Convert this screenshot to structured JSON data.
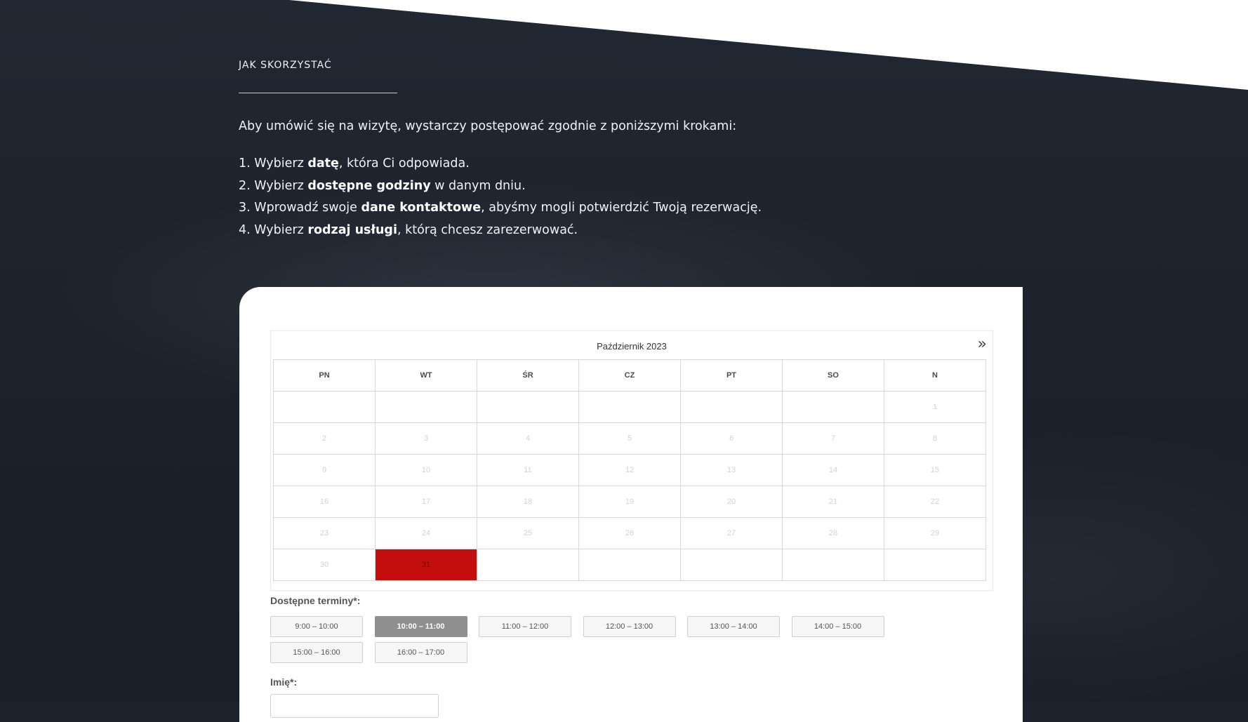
{
  "intro": {
    "section_title": "JAK SKORZYSTAĆ",
    "lead": "Aby umówić się na wizytę, wystarczy postępować zgodnie z poniższymi krokami:",
    "steps": [
      {
        "num": "1.",
        "before": "Wybierz ",
        "bold": "datę",
        "after": ", która Ci odpowiada."
      },
      {
        "num": "2.",
        "before": "Wybierz ",
        "bold": "dostępne godziny",
        "after": " w danym dniu."
      },
      {
        "num": "3.",
        "before": "Wprowadź swoje ",
        "bold": "dane kontaktowe",
        "after": ", abyśmy mogli potwierdzić Twoją rezerwację."
      },
      {
        "num": "4.",
        "before": "Wybierz ",
        "bold": "rodzaj usługi",
        "after": ", którą chcesz zarezerwować."
      }
    ]
  },
  "calendar": {
    "month_label": "Październik 2023",
    "next_icon": "»",
    "weekdays": [
      "PN",
      "WT",
      "ŚR",
      "CZ",
      "PT",
      "SO",
      "N"
    ],
    "weeks": [
      [
        "",
        "",
        "",
        "",
        "",
        "",
        "1"
      ],
      [
        "2",
        "3",
        "4",
        "5",
        "6",
        "7",
        "8"
      ],
      [
        "9",
        "10",
        "11",
        "12",
        "13",
        "14",
        "15"
      ],
      [
        "16",
        "17",
        "18",
        "19",
        "20",
        "21",
        "22"
      ],
      [
        "23",
        "24",
        "25",
        "26",
        "27",
        "28",
        "29"
      ],
      [
        "30",
        "31",
        "",
        "",
        "",
        "",
        ""
      ]
    ],
    "selected_day": "31",
    "selected_color": "#c40e0e"
  },
  "booking": {
    "slots_label": "Dostępne terminy*:",
    "slots": [
      "9:00 – 10:00",
      "10:00 – 11:00",
      "11:00 – 12:00",
      "12:00 – 13:00",
      "13:00 – 14:00",
      "14:00 – 15:00",
      "15:00 – 16:00",
      "16:00 – 17:00"
    ],
    "selected_slot": "10:00 – 11:00",
    "name_label": "Imię*:",
    "name_value": ""
  }
}
